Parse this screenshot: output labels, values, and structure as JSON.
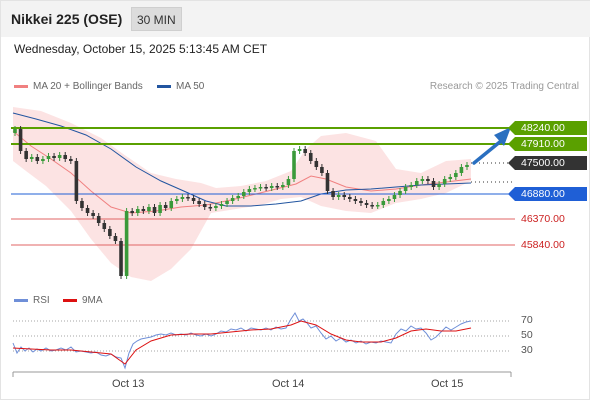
{
  "header": {
    "title": "Nikkei 225 (OSE)",
    "timeframe": "30 MIN"
  },
  "datetime": "Wednesday, October 15, 2025 5:13:45 AM CET",
  "legend": {
    "ma20_label": "MA 20 + Bollinger Bands",
    "ma20_color": "#f08080",
    "ma50_label": "MA 50",
    "ma50_color": "#2255a0"
  },
  "credit": "Research © 2025 Trading Central",
  "levels": {
    "r2": "48240.00",
    "r1": "47910.00",
    "last": "47500.00",
    "s1": "46880.00",
    "s2": "46370.00",
    "s3": "45840.00",
    "resistance_color": "#5aa000",
    "last_color": "#333333",
    "pivot_color": "#1f5fd6",
    "support_color": "#cc2222"
  },
  "rsi": {
    "rsi_label": "RSI",
    "rsi_color": "#6f8fd8",
    "ma_label": "9MA",
    "ma_color": "#dd1111",
    "ticks": [
      "70",
      "50",
      "30"
    ]
  },
  "dates": [
    "Oct 13",
    "Oct 14",
    "Oct 15"
  ]
}
